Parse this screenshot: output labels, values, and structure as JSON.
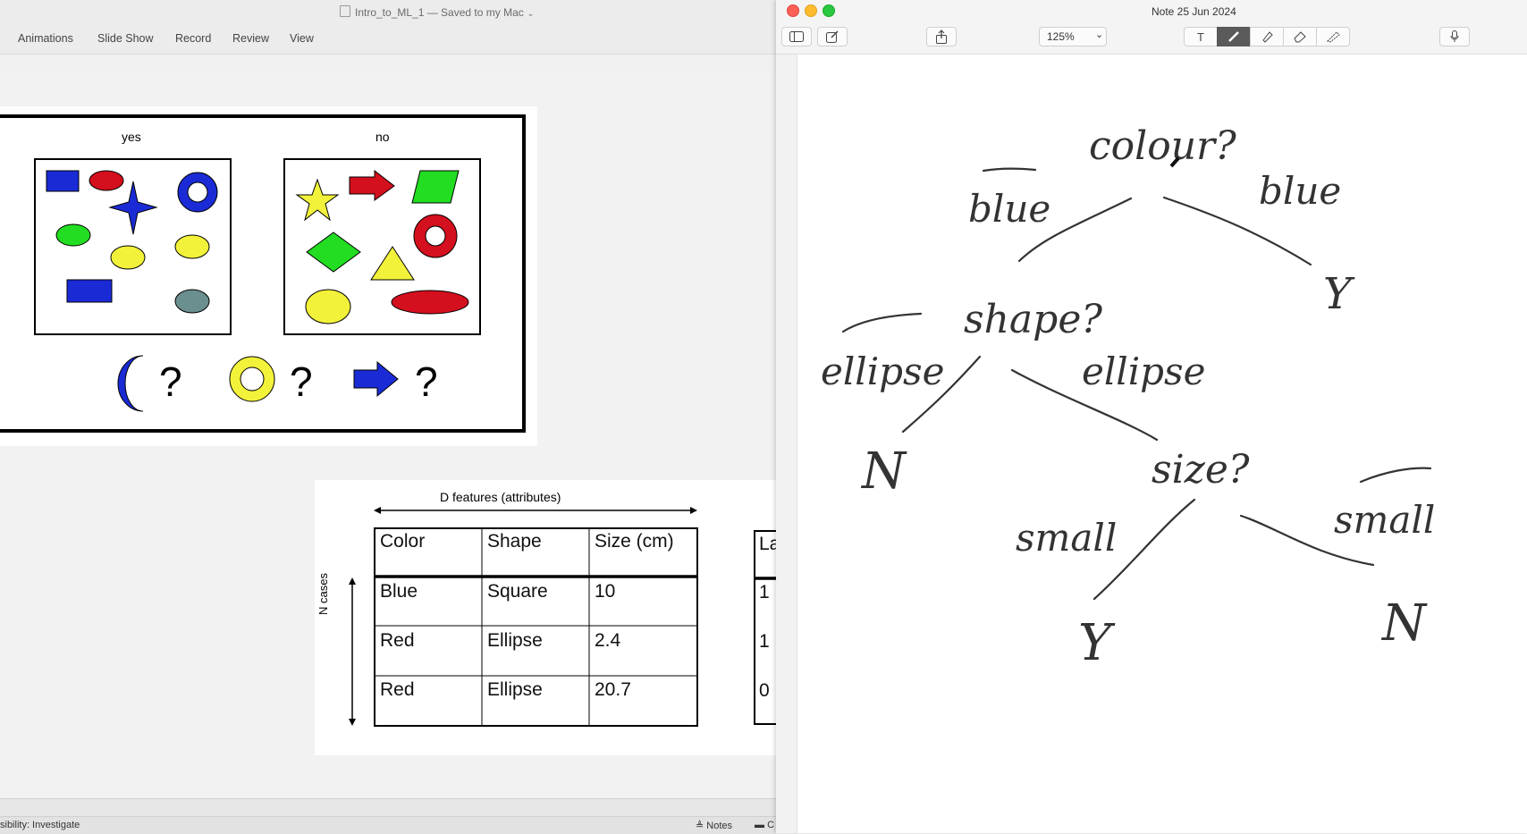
{
  "powerpoint": {
    "title": "Intro_to_ML_1 — Saved to my Mac",
    "menu": [
      "Animations",
      "Slide Show",
      "Record",
      "Review",
      "View"
    ],
    "status": "sibility: Investigate",
    "notes_label": "Notes",
    "comments_label": "C"
  },
  "slide1": {
    "yes_label": "yes",
    "no_label": "no",
    "question_marks": [
      "?",
      "?",
      "?"
    ]
  },
  "slide2": {
    "header": "D features (attributes)",
    "side_label": "N cases",
    "columns": [
      "Color",
      "Shape",
      "Size (cm)"
    ],
    "rows": [
      [
        "Blue",
        "Square",
        "10"
      ],
      [
        "Red",
        "Ellipse",
        "2.4"
      ],
      [
        "Red",
        "Ellipse",
        "20.7"
      ]
    ],
    "label_column_header": "La",
    "label_values": [
      "1",
      "1",
      "0"
    ]
  },
  "notes_app": {
    "title": "Note 25 Jun 2024",
    "zoom": "125%",
    "toolbar_icons": [
      "sidebar-icon",
      "compose-icon",
      "share-icon",
      "text-tool-icon",
      "pen-tool-icon",
      "highlighter-icon",
      "eraser-icon",
      "lasso-icon",
      "microphone-icon"
    ]
  },
  "handwriting": {
    "root": "colour?",
    "branch_left_root": "blue",
    "branch_right_root": "blue",
    "leaf_right_root": "Y",
    "node_shape": "shape?",
    "branch_left_shape": "ellipse",
    "branch_right_shape": "ellipse",
    "leaf_left_shape": "N",
    "node_size": "size?",
    "branch_left_size": "small",
    "branch_right_size": "small",
    "leaf_left_size": "Y",
    "leaf_right_size": "N"
  }
}
